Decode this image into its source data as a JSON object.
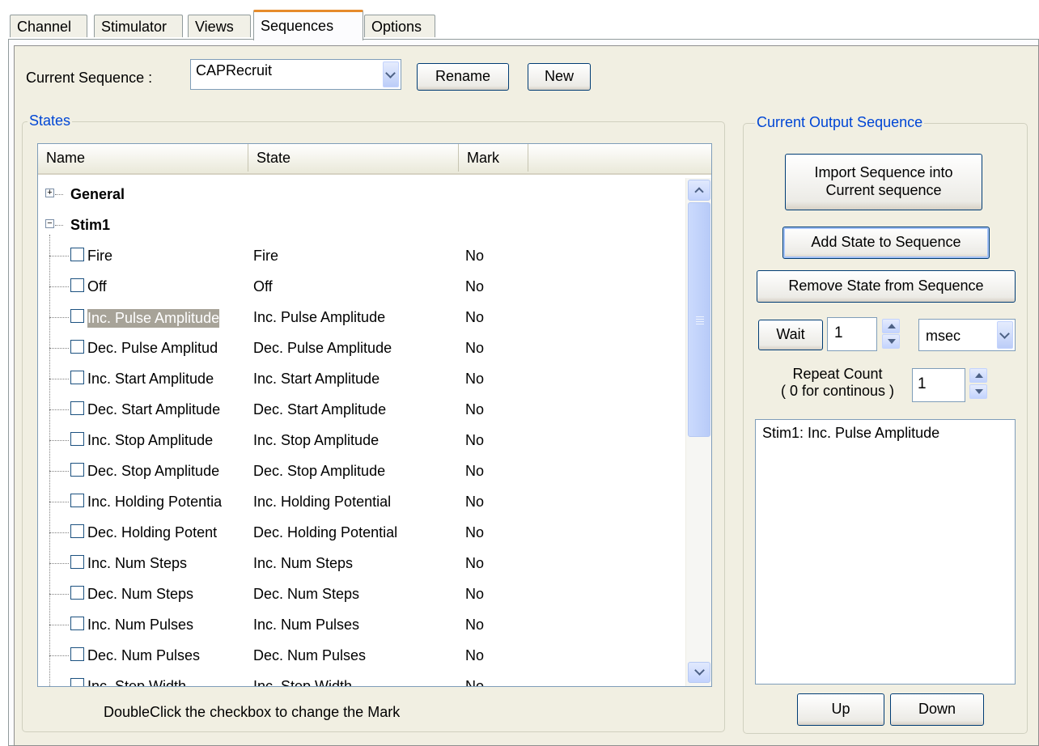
{
  "tabs": [
    {
      "label": "Channel"
    },
    {
      "label": "Stimulator"
    },
    {
      "label": "Views"
    },
    {
      "label": "Sequences"
    },
    {
      "label": "Options"
    }
  ],
  "active_tab": "Sequences",
  "current_sequence": {
    "label": "Current Sequence :",
    "value": "CAPRecruit",
    "rename_label": "Rename",
    "new_label": "New"
  },
  "states": {
    "title": "States",
    "columns": [
      "Name",
      "State",
      "Mark"
    ],
    "groups": [
      {
        "name": "General",
        "expanded": false
      },
      {
        "name": "Stim1",
        "expanded": true
      }
    ],
    "rows": [
      {
        "name": "Fire",
        "state": "Fire",
        "mark": "No"
      },
      {
        "name": "Off",
        "state": "Off",
        "mark": "No"
      },
      {
        "name": "Inc. Pulse Amplitude",
        "state": "Inc. Pulse Amplitude",
        "mark": "No"
      },
      {
        "name": "Dec. Pulse Amplitud",
        "state": "Dec. Pulse Amplitude",
        "mark": "No"
      },
      {
        "name": "Inc. Start Amplitude",
        "state": "Inc. Start Amplitude",
        "mark": "No"
      },
      {
        "name": "Dec. Start Amplitude",
        "state": "Dec. Start Amplitude",
        "mark": "No"
      },
      {
        "name": "Inc. Stop Amplitude",
        "state": "Inc. Stop Amplitude",
        "mark": "No"
      },
      {
        "name": "Dec. Stop Amplitude",
        "state": "Dec. Stop Amplitude",
        "mark": "No"
      },
      {
        "name": "Inc. Holding Potentia",
        "state": "Inc. Holding Potential",
        "mark": "No"
      },
      {
        "name": "Dec. Holding Potent",
        "state": "Dec. Holding Potential",
        "mark": "No"
      },
      {
        "name": "Inc. Num Steps",
        "state": "Inc. Num Steps",
        "mark": "No"
      },
      {
        "name": "Dec. Num Steps",
        "state": "Dec. Num Steps",
        "mark": "No"
      },
      {
        "name": "Inc. Num Pulses",
        "state": "Inc. Num Pulses",
        "mark": "No"
      },
      {
        "name": "Dec. Num Pulses",
        "state": "Dec. Num Pulses",
        "mark": "No"
      },
      {
        "name": "Inc. Step Width",
        "state": "Inc. Step Width",
        "mark": "No"
      }
    ],
    "selected_row": "Inc. Pulse Amplitude",
    "hint": "DoubleClick the checkbox to change the Mark"
  },
  "output": {
    "title": "Current Output Sequence",
    "import_label_1": "Import Sequence into",
    "import_label_2": "Current sequence",
    "add_label": "Add State to Sequence",
    "remove_label": "Remove State from Sequence",
    "wait_label": "Wait",
    "wait_value": "1",
    "unit_value": "msec",
    "repeat_label_1": "Repeat Count",
    "repeat_label_2": "( 0 for continous )",
    "repeat_value": "1",
    "sequence_items": [
      "Stim1: Inc. Pulse Amplitude"
    ],
    "up_label": "Up",
    "down_label": "Down"
  },
  "colors": {
    "tab_highlight": "#e68b2c",
    "groupbox_title": "#0046d5",
    "selection_bg": "#a7a398",
    "panel_bg": "#f1efe2"
  }
}
